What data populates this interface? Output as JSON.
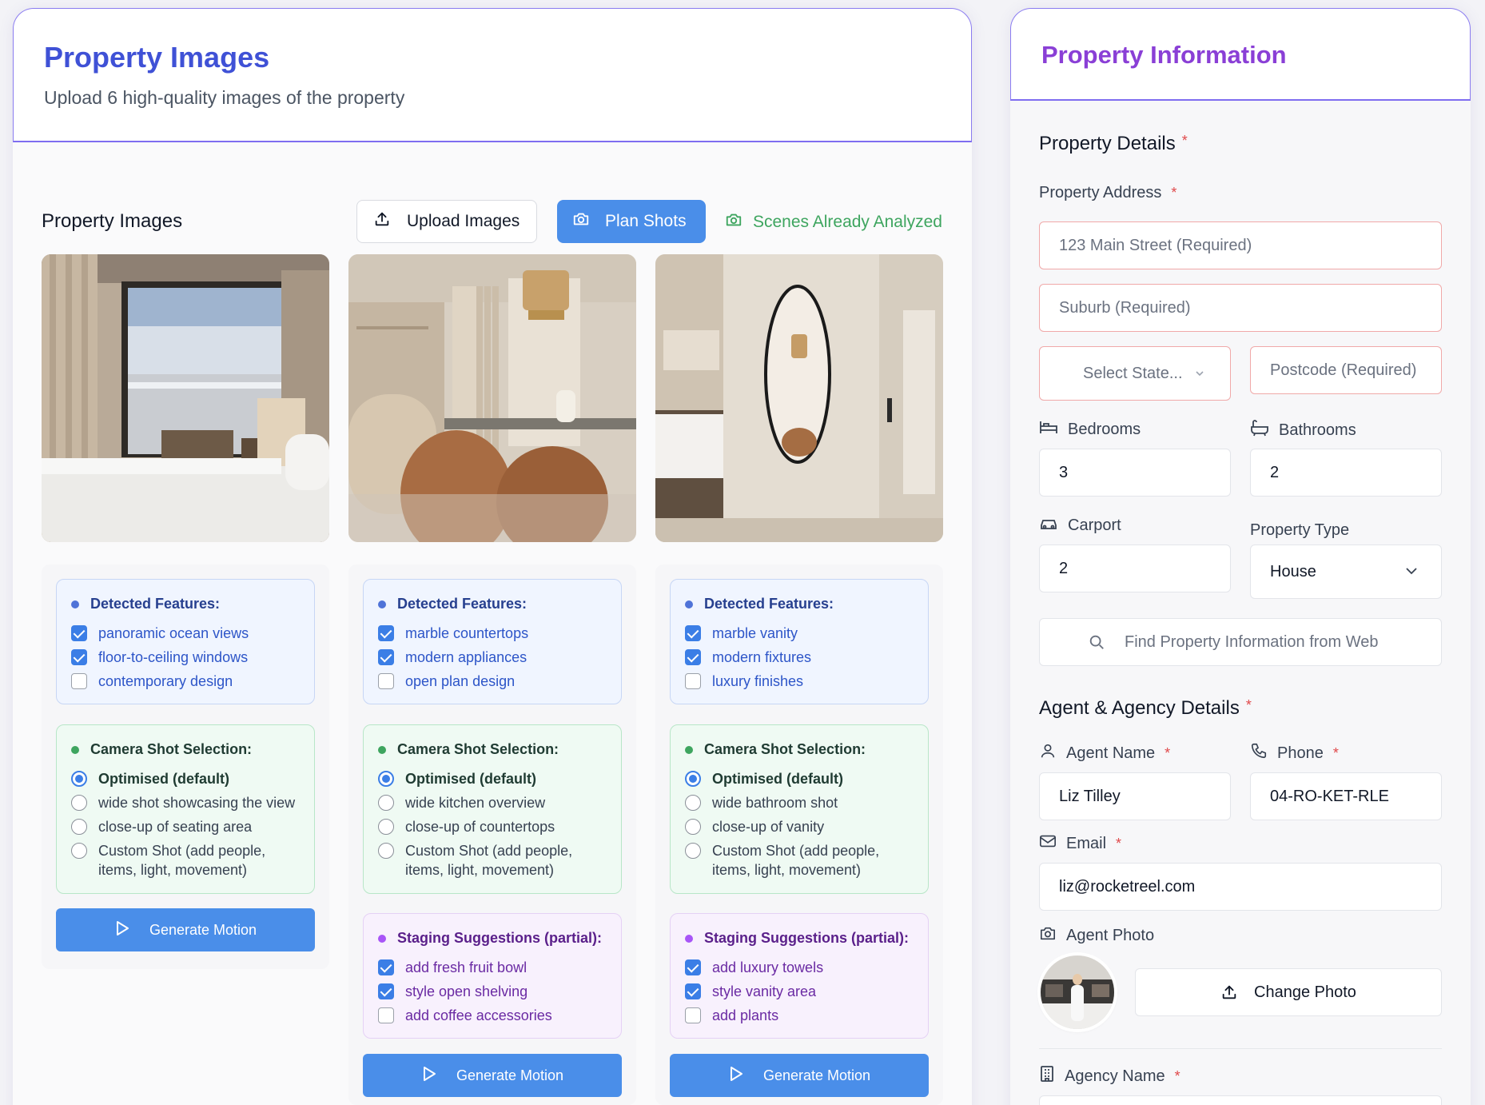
{
  "left": {
    "title": "Property Images",
    "subtitle": "Upload 6 high-quality images of the property",
    "section_label": "Property Images",
    "upload_label": "Upload Images",
    "plan_label": "Plan Shots",
    "scenes_status": "Scenes Already Analyzed"
  },
  "columns": [
    {
      "detected_title": "Detected Features:",
      "features": [
        {
          "label": "panoramic ocean views",
          "checked": true
        },
        {
          "label": "floor-to-ceiling windows",
          "checked": true
        },
        {
          "label": "contemporary design",
          "checked": false
        }
      ],
      "camera_title": "Camera Shot Selection:",
      "shots": [
        {
          "label": "Optimised (default)",
          "selected": true
        },
        {
          "label": "wide shot showcasing the view",
          "selected": false
        },
        {
          "label": "close-up of seating area",
          "selected": false
        },
        {
          "label": "Custom Shot (add people, items, light, movement)",
          "selected": false
        }
      ],
      "staging_title": "",
      "staging": [],
      "generate_label": "Generate Motion"
    },
    {
      "detected_title": "Detected Features:",
      "features": [
        {
          "label": "marble countertops",
          "checked": true
        },
        {
          "label": "modern appliances",
          "checked": true
        },
        {
          "label": "open plan design",
          "checked": false
        }
      ],
      "camera_title": "Camera Shot Selection:",
      "shots": [
        {
          "label": "Optimised (default)",
          "selected": true
        },
        {
          "label": "wide kitchen overview",
          "selected": false
        },
        {
          "label": "close-up of countertops",
          "selected": false
        },
        {
          "label": "Custom Shot (add people, items, light, movement)",
          "selected": false
        }
      ],
      "staging_title": "Staging Suggestions (partial):",
      "staging": [
        {
          "label": "add fresh fruit bowl",
          "checked": true
        },
        {
          "label": "style open shelving",
          "checked": true
        },
        {
          "label": "add coffee accessories",
          "checked": false
        }
      ],
      "generate_label": "Generate Motion"
    },
    {
      "detected_title": "Detected Features:",
      "features": [
        {
          "label": "marble vanity",
          "checked": true
        },
        {
          "label": "modern fixtures",
          "checked": true
        },
        {
          "label": "luxury finishes",
          "checked": false
        }
      ],
      "camera_title": "Camera Shot Selection:",
      "shots": [
        {
          "label": "Optimised (default)",
          "selected": true
        },
        {
          "label": "wide bathroom shot",
          "selected": false
        },
        {
          "label": "close-up of vanity",
          "selected": false
        },
        {
          "label": "Custom Shot (add people, items, light, movement)",
          "selected": false
        }
      ],
      "staging_title": "Staging Suggestions (partial):",
      "staging": [
        {
          "label": "add luxury towels",
          "checked": true
        },
        {
          "label": "style vanity area",
          "checked": true
        },
        {
          "label": "add plants",
          "checked": false
        }
      ],
      "generate_label": "Generate Motion"
    }
  ],
  "right": {
    "title": "Property Information",
    "property_details": "Property Details",
    "address_label": "Property Address",
    "street_placeholder": "123 Main Street (Required)",
    "suburb_placeholder": "Suburb (Required)",
    "state_placeholder": "Select State...",
    "postcode_placeholder": "Postcode (Required)",
    "bedrooms_label": "Bedrooms",
    "bedrooms_value": "3",
    "bathrooms_label": "Bathrooms",
    "bathrooms_value": "2",
    "carport_label": "Carport",
    "carport_value": "2",
    "property_type_label": "Property Type",
    "property_type_value": "House",
    "find_web_label": "Find Property Information from Web",
    "agent_section": "Agent & Agency Details",
    "agent_name_label": "Agent Name",
    "agent_name_value": "Liz Tilley",
    "phone_label": "Phone",
    "phone_value": "04-RO-KET-RLE",
    "email_label": "Email",
    "email_value": "liz@rocketreel.com",
    "agent_photo_label": "Agent Photo",
    "change_photo_label": "Change Photo",
    "agency_name_label": "Agency Name",
    "required_mark": "*"
  },
  "colors": {
    "accent_blue": "#4a8ee9",
    "title_blue": "#3f51d6",
    "title_purple": "#8a3fd6",
    "success_green": "#3ea55f",
    "required_red": "#e0494b"
  }
}
